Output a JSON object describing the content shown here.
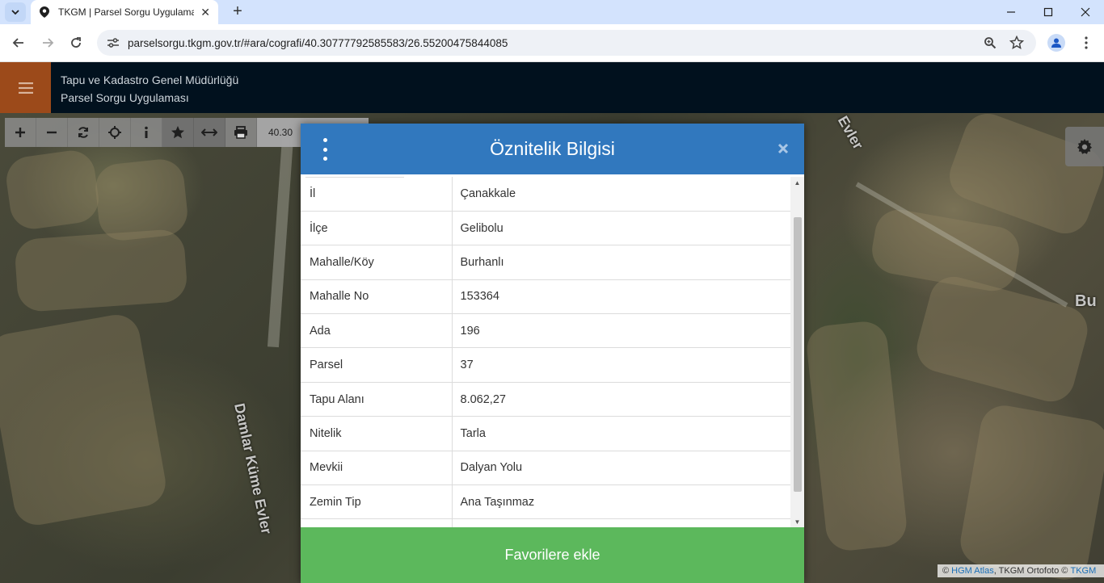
{
  "browser": {
    "tab_title": "TKGM | Parsel Sorgu Uygulaması",
    "url": "parselsorgu.tkgm.gov.tr/#ara/cografi/40.30777792585583/26.55200475844085"
  },
  "app": {
    "header_line1": "Tapu ve Kadastro Genel Müdürlüğü",
    "header_line2": "Parsel Sorgu Uygulaması"
  },
  "map_toolbar": {
    "coord_value": "40.30"
  },
  "map": {
    "label_road1": "Damlar Küme Evler",
    "label_road2": "Bu",
    "label_road3": "Evler"
  },
  "attribution": {
    "prefix": "©",
    "hgm": "HGM Atlas",
    "middle": ", TKGM Ortofoto ©",
    "tkgm": "TKGM"
  },
  "modal": {
    "title": "Öznitelik Bilgisi",
    "rows": [
      {
        "key": "İl",
        "value": "Çanakkale"
      },
      {
        "key": "İlçe",
        "value": "Gelibolu"
      },
      {
        "key": "Mahalle/Köy",
        "value": "Burhanlı"
      },
      {
        "key": "Mahalle No",
        "value": "153364"
      },
      {
        "key": "Ada",
        "value": "196"
      },
      {
        "key": "Parsel",
        "value": "37"
      },
      {
        "key": "Tapu Alanı",
        "value": "8.062,27"
      },
      {
        "key": "Nitelik",
        "value": "Tarla"
      },
      {
        "key": "Mevkii",
        "value": "Dalyan Yolu"
      },
      {
        "key": "Zemin Tip",
        "value": "Ana Taşınmaz"
      },
      {
        "key": "",
        "value": ""
      }
    ],
    "fav_button": "Favorilere ekle"
  },
  "colors": {
    "header_bg": "#01111e",
    "hamburger_bg": "#9c4a1a",
    "modal_header": "#3178be",
    "fav_green": "#5cb85c"
  }
}
